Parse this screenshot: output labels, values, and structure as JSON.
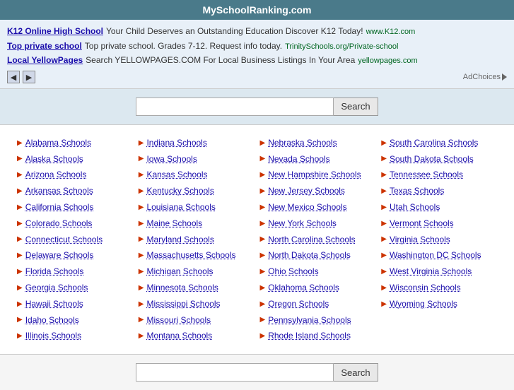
{
  "header": {
    "title": "MySchoolRanking.com"
  },
  "ads": [
    {
      "link_text": "K12 Online High School",
      "body_text": "Your Child Deserves an Outstanding Education Discover K12 Today!",
      "url": "www.K12.com"
    },
    {
      "link_text": "Top private school",
      "body_text": "Top private school. Grades 7-12. Request info today.",
      "url": "TrinitySchools.org/Private-school"
    },
    {
      "link_text": "Local YellowPages",
      "body_text": "Search YELLOWPAGES.COM For Local Business Listings In Your Area",
      "url": "yellowpages.com"
    }
  ],
  "ad_nav": {
    "prev_label": "◀",
    "next_label": "▶"
  },
  "ad_choices_label": "AdChoices",
  "search": {
    "top_placeholder": "",
    "bottom_placeholder": "",
    "button_label": "Search"
  },
  "states": {
    "col1": [
      "Alabama Schools",
      "Alaska Schools",
      "Arizona Schools",
      "Arkansas Schools",
      "California Schools",
      "Colorado Schools",
      "Connecticut Schools",
      "Delaware Schools",
      "Florida Schools",
      "Georgia Schools",
      "Hawaii Schools",
      "Idaho Schools",
      "Illinois Schools"
    ],
    "col2": [
      "Indiana Schools",
      "Iowa Schools",
      "Kansas Schools",
      "Kentucky Schools",
      "Louisiana Schools",
      "Maine Schools",
      "Maryland Schools",
      "Massachusetts Schools",
      "Michigan Schools",
      "Minnesota Schools",
      "Mississippi Schools",
      "Missouri Schools",
      "Montana Schools"
    ],
    "col3": [
      "Nebraska Schools",
      "Nevada Schools",
      "New Hampshire Schools",
      "New Jersey Schools",
      "New Mexico Schools",
      "New York Schools",
      "North Carolina Schools",
      "North Dakota Schools",
      "Ohio Schools",
      "Oklahoma Schools",
      "Oregon Schools",
      "Pennsylvania Schools",
      "Rhode Island Schools"
    ],
    "col4": [
      "South Carolina Schools",
      "South Dakota Schools",
      "Tennessee Schools",
      "Texas Schools",
      "Utah Schools",
      "Vermont Schools",
      "Virginia Schools",
      "Washington DC Schools",
      "West Virginia Schools",
      "Wisconsin Schools",
      "Wyoming Schools"
    ]
  }
}
